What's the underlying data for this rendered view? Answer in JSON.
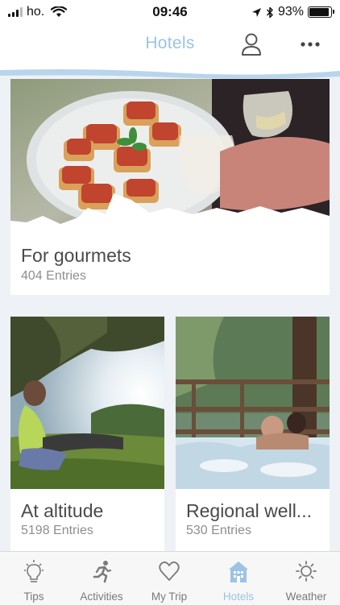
{
  "status_bar": {
    "carrier": "ho.",
    "time": "09:46",
    "battery": "93%",
    "battery_level": 0.93
  },
  "nav": {
    "title": "Hotels",
    "title_color": "#9cc3e3",
    "profile_icon": "person-icon",
    "more_icon": "ellipsis-icon"
  },
  "cards": [
    {
      "title": "For gourmets",
      "entries": "404 Entries"
    },
    {
      "title": "At altitude",
      "entries": "5198 Entries"
    },
    {
      "title": "Regional well...",
      "entries": "530 Entries"
    }
  ],
  "tabs": [
    {
      "label": "Tips",
      "icon": "lightbulb-icon"
    },
    {
      "label": "Activities",
      "icon": "runner-icon"
    },
    {
      "label": "My Trip",
      "icon": "heart-icon"
    },
    {
      "label": "Hotels",
      "icon": "hotel-icon",
      "active": true
    },
    {
      "label": "Weather",
      "icon": "sun-icon"
    }
  ],
  "colors": {
    "accent": "#9cc3e3",
    "background": "#eef1f6",
    "tab_inactive": "#7a7a7a"
  }
}
